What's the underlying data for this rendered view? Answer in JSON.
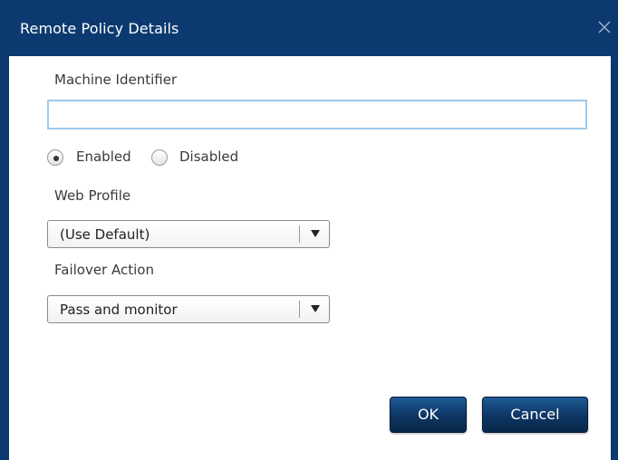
{
  "dialog": {
    "title": "Remote Policy Details",
    "close_icon": "close-icon",
    "colors": {
      "frame": "#0c3a70",
      "button": "#0d3563",
      "input_border": "#9ecbe9"
    }
  },
  "machine_identifier": {
    "label": "Machine Identifier",
    "value": "",
    "placeholder": ""
  },
  "status": {
    "options": [
      {
        "label": "Enabled",
        "selected": true
      },
      {
        "label": "Disabled",
        "selected": false
      }
    ]
  },
  "web_profile": {
    "label": "Web Profile",
    "value": "(Use Default)"
  },
  "failover_action": {
    "label": "Failover Action",
    "value": "Pass and monitor"
  },
  "buttons": {
    "ok": "OK",
    "cancel": "Cancel"
  }
}
